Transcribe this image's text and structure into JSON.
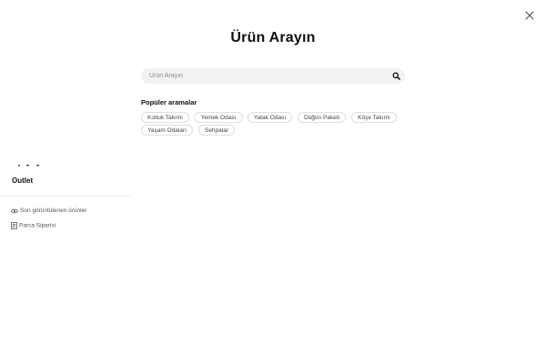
{
  "search_modal": {
    "title": "Ürün Arayın",
    "search": {
      "placeholder": "Ürün Arayın",
      "value": ""
    },
    "popular": {
      "heading": "Popüler aramalar",
      "items": [
        "Koltuk Takımı",
        "Yemek Odası",
        "Yatak Odası",
        "Düğün Paketi",
        "Köşe Takımı",
        "Yaşam Odaları",
        "Sehpalar"
      ]
    }
  },
  "sidebar": {
    "outlet_label": "Outlet",
    "links": [
      {
        "label": "Son görüntülenen ürünler",
        "icon": "eye-icon"
      },
      {
        "label": "Parca Siparisi",
        "icon": "receipt-icon"
      }
    ]
  },
  "colors": {
    "background": "#ffffff",
    "search_background": "#f2f2f2",
    "chip_border": "#dedede",
    "text": "#111111"
  }
}
